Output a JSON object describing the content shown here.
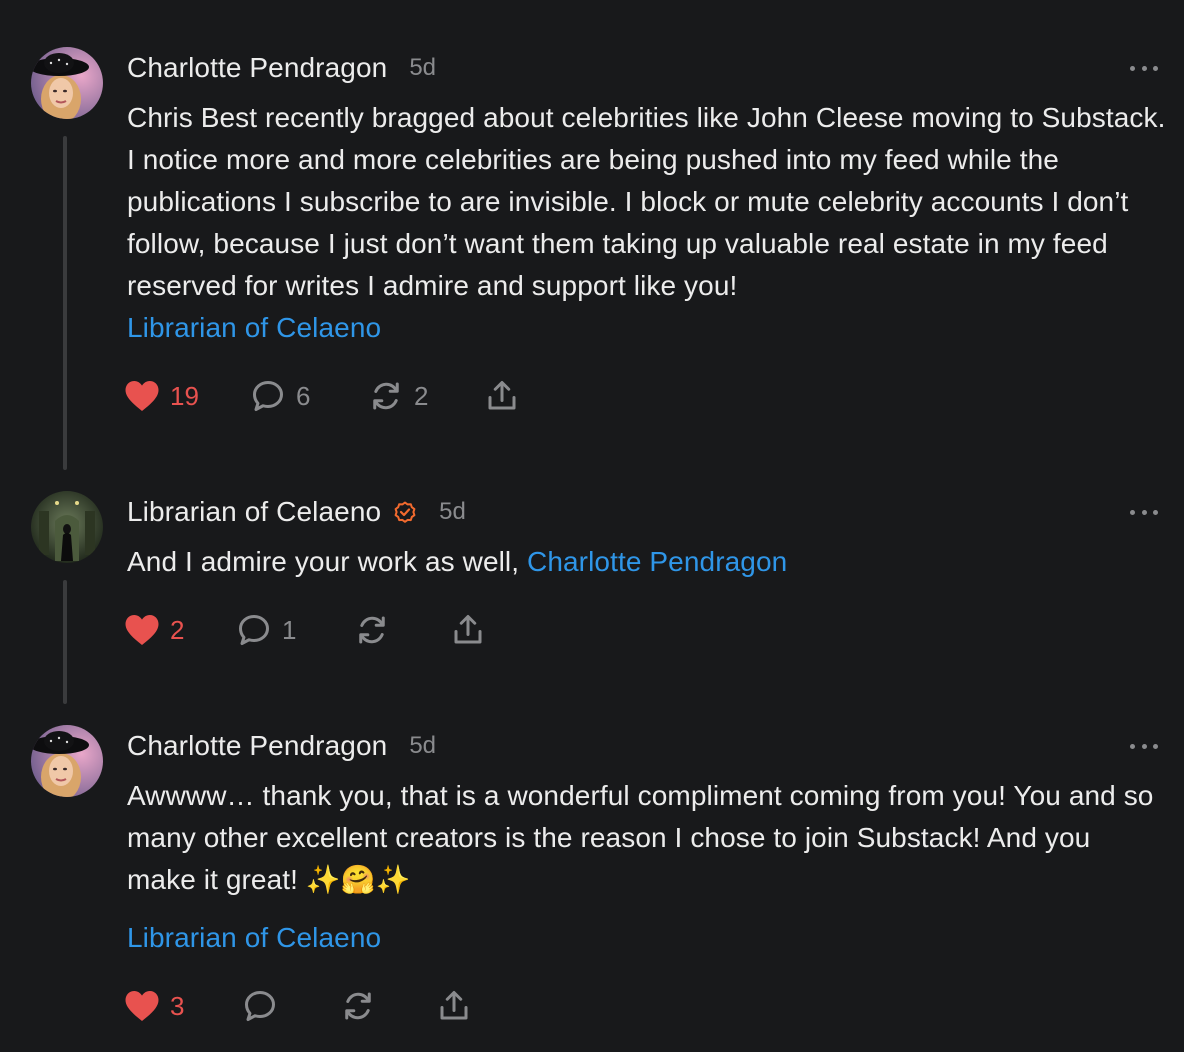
{
  "comments": [
    {
      "author": "Charlotte Pendragon",
      "time": "5d",
      "body": "Chris Best recently bragged about celebrities like John Cleese moving to Substack. I notice more and more celebrities are being pushed into my feed while the publications I subscribe to are invisible. I block or mute celebrity accounts I don’t follow, because I just don’t want them taking up valuable real estate in my feed reserved for writes I admire and support like you!",
      "mention": "Librarian of Celaeno",
      "likes": "19",
      "replies": "6",
      "restacks": "2"
    },
    {
      "author": "Librarian of Celaeno",
      "time": "5d",
      "body": "And I admire your work as well, ",
      "mention": "Charlotte Pendragon",
      "likes": "2",
      "replies": "1",
      "restacks": ""
    },
    {
      "author": "Charlotte Pendragon",
      "time": "5d",
      "body": "Awwww… thank you, that is a wonderful compliment coming from you! You and so many other excellent creators is the reason I chose to join Substack! And you make it great! ✨🤗✨",
      "mention": "Librarian of Celaeno",
      "likes": "3",
      "replies": "",
      "restacks": ""
    }
  ],
  "icons": {
    "like": "heart-icon",
    "reply": "comment-bubble-icon",
    "restack": "restack-icon",
    "share": "share-icon",
    "more": "more-dots-icon",
    "verified": "verified-badge-icon"
  },
  "colors": {
    "background": "#18191b",
    "text": "#ececec",
    "muted": "#8a8b8e",
    "link": "#2f96e8",
    "like": "#e8524f",
    "verified": "#f26a2e"
  }
}
